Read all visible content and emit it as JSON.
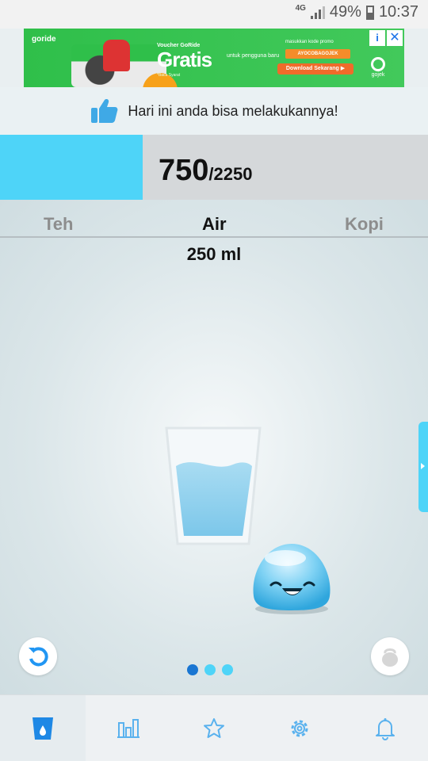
{
  "status_bar": {
    "network": "4G",
    "battery": "49%",
    "time": "10:37"
  },
  "ad": {
    "brand": "goride",
    "voucher": "Voucher GoRide",
    "headline": "Gratis",
    "sub": "untuk pengguna baru",
    "terms": "*Baca Syarat",
    "pre_code": "masukkan kode promo",
    "promo_code": "AYOCOBAGOJEK",
    "download": "Download Sekarang ▶",
    "sponsor": "gojek",
    "info_icon": "i",
    "close_icon": "✕"
  },
  "motivation": {
    "text": "Hari ini anda bisa melakukannya!"
  },
  "progress": {
    "current": "750",
    "goal": "/2250",
    "fraction": 0.333
  },
  "tabs": [
    {
      "label": "Teh"
    },
    {
      "label": "Air"
    },
    {
      "label": "Kopi"
    }
  ],
  "selected_tab": "Air",
  "volume": "250 ml",
  "pager": {
    "count": 3,
    "active": 0
  },
  "nav": [
    {
      "icon": "glass-icon"
    },
    {
      "icon": "stats-icon"
    },
    {
      "icon": "star-icon"
    },
    {
      "icon": "settings-icon"
    },
    {
      "icon": "bell-icon"
    }
  ],
  "colors": {
    "accent": "#4ed4f8",
    "active_dot": "#1976d2",
    "ad_green": "#2fbf4a"
  }
}
